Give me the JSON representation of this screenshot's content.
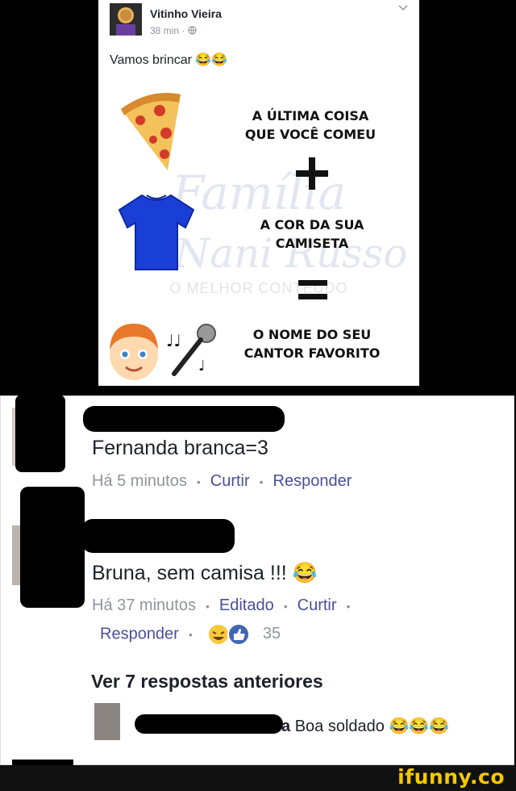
{
  "post": {
    "author": "Vitinho Vieira",
    "time": "38 min",
    "privacy_icon": "globe-icon",
    "text": "Vamos brincar",
    "text_emojis": "😂😂",
    "game": {
      "line1": "A ÚLTIMA COISA\nQUE VOCÊ COMEU",
      "operator_plus": "plus-sign",
      "line2": "A COR DA SUA\nCAMISETA",
      "operator_equals": "equals-sign",
      "line3": "O NOME DO SEU\nCANTOR FAVORITO",
      "watermark_main": "Família",
      "watermark_sub": "Nani Russo",
      "watermark_tag": "O MELHOR CONTEÚDO"
    }
  },
  "comments": [
    {
      "text": "Fernanda branca=3",
      "time": "Há 5 minutos",
      "like": "Curtir",
      "reply": "Responder"
    },
    {
      "text": "Bruna, sem camisa !!!",
      "text_emoji": "😂",
      "time": "Há 37 minutos",
      "edited": "Editado",
      "like": "Curtir",
      "reply": "Responder",
      "reaction_count": "35"
    }
  ],
  "see_more": "Ver 7 respostas anteriores",
  "reply_preview": {
    "name_tail": "a",
    "text": "Boa soldado",
    "emojis": "😂😂😂"
  },
  "footer": {
    "brand": "ifunny.co"
  },
  "colors": {
    "link": "#4b4f9a",
    "muted": "#90949c",
    "brand": "#f5c900",
    "shirt": "#1a3fd6"
  }
}
